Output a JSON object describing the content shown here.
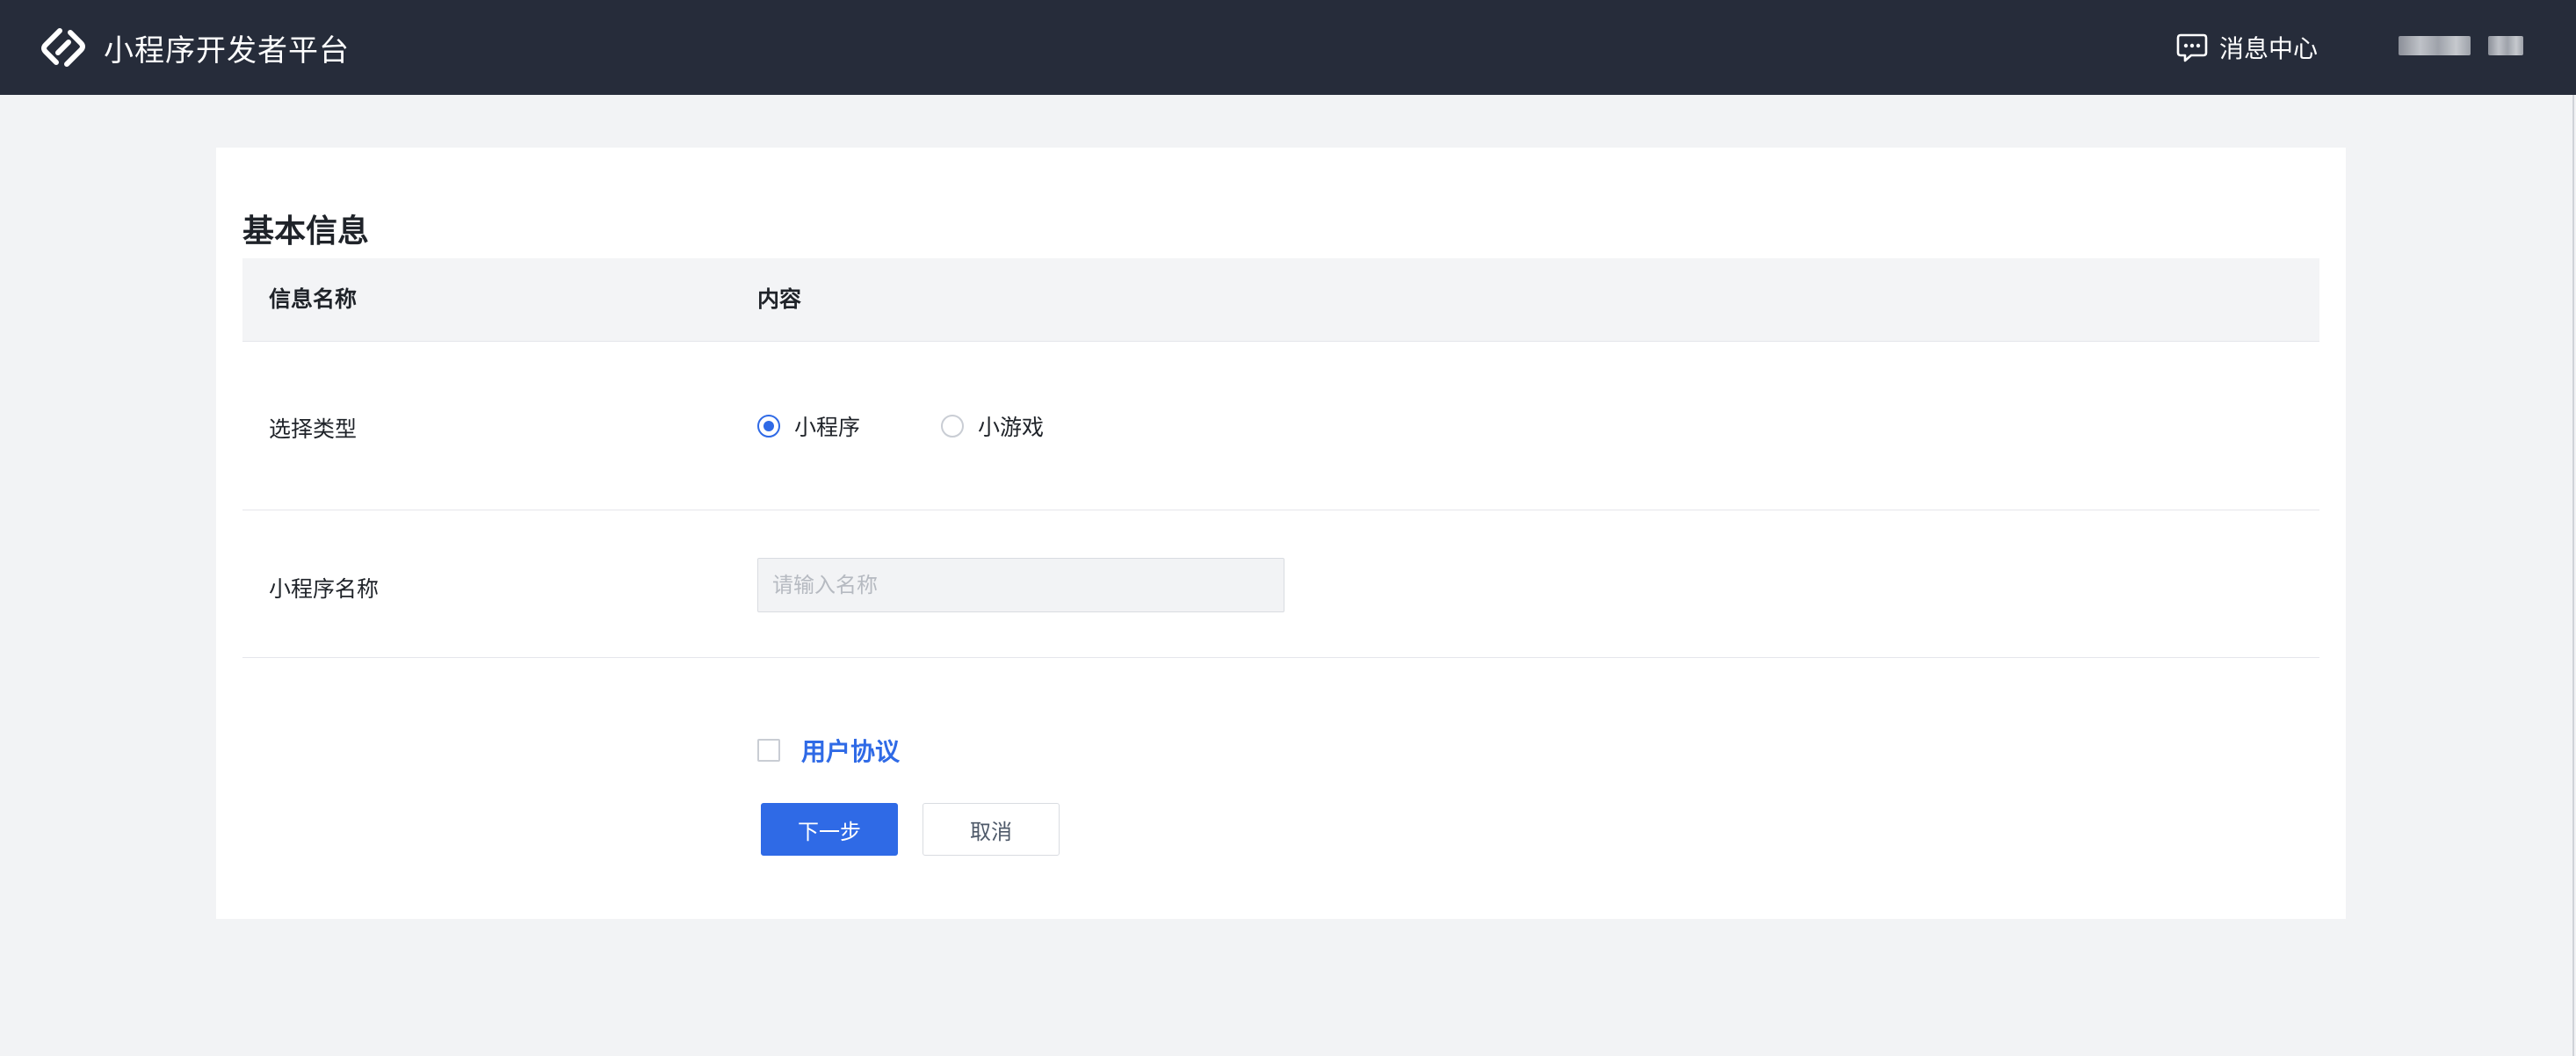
{
  "header": {
    "brand_title": "小程序开发者平台",
    "logo_icon": "mini-program-logo-icon",
    "message_center_label": "消息中心",
    "message_icon": "message-bubble-icon"
  },
  "form": {
    "section_title": "基本信息",
    "table_headers": {
      "name": "信息名称",
      "content": "内容"
    },
    "type_row": {
      "label": "选择类型",
      "options": [
        {
          "label": "小程序",
          "checked": true
        },
        {
          "label": "小游戏",
          "checked": false
        }
      ]
    },
    "name_row": {
      "label": "小程序名称",
      "placeholder": "请输入名称",
      "value": ""
    },
    "agreement": {
      "checked": false,
      "link_label": "用户协议"
    },
    "buttons": {
      "next_label": "下一步",
      "cancel_label": "取消"
    }
  },
  "colors": {
    "topbar_bg": "#262c3a",
    "accent": "#2f6ae6",
    "page_bg": "#f2f3f5"
  }
}
